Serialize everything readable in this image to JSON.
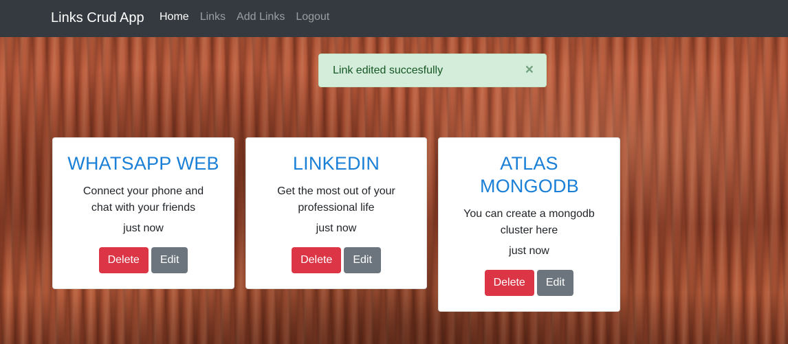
{
  "navbar": {
    "brand": "Links Crud App",
    "links": [
      {
        "label": "Home",
        "active": true
      },
      {
        "label": "Links",
        "active": false
      },
      {
        "label": "Add Links",
        "active": false
      },
      {
        "label": "Logout",
        "active": false
      }
    ]
  },
  "alert": {
    "message": "Link edited succesfully",
    "close_symbol": "×"
  },
  "cards": [
    {
      "title": "WHATSAPP WEB",
      "description": "Connect your phone and chat with your friends",
      "time": "just now",
      "delete_label": "Delete",
      "edit_label": "Edit"
    },
    {
      "title": "LINKEDIN",
      "description": "Get the most out of your professional life",
      "time": "just now",
      "delete_label": "Delete",
      "edit_label": "Edit"
    },
    {
      "title": "ATLAS MONGODB",
      "description": "You can create a mongodb cluster here",
      "time": "just now",
      "delete_label": "Delete",
      "edit_label": "Edit"
    }
  ],
  "colors": {
    "navbar_bg": "#343a40",
    "title_blue": "#1a7fd6",
    "danger": "#dc3545",
    "secondary": "#6c757d",
    "alert_bg": "#d4edda"
  }
}
